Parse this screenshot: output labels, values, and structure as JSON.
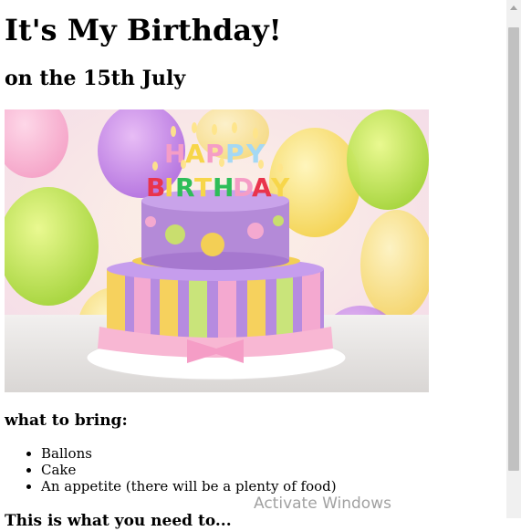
{
  "page": {
    "title": "It's My Birthday!",
    "subtitle": "on the 15th July",
    "bring_heading": "what to bring:",
    "bring_items": [
      "Ballons",
      "Cake",
      "An appetite (there will be a plenty of food)"
    ],
    "cutoff_heading": "This is what you need to..."
  },
  "hero_image": {
    "description": "birthday-cake-photo",
    "candle_letters": "HAPPY BIRTHDAY"
  },
  "overlay": {
    "watermark": "Activate Windows"
  },
  "colors": {
    "scrollbar_track": "#f0f0f0",
    "scrollbar_thumb": "#c1c1c1"
  }
}
